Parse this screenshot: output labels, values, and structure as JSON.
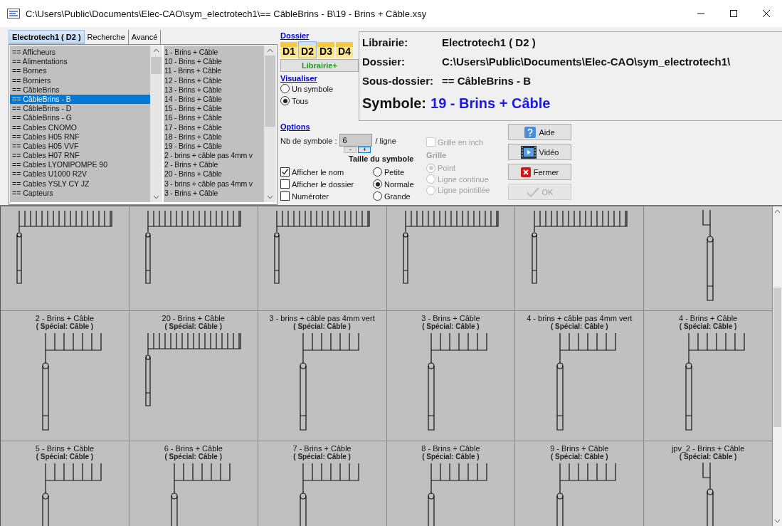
{
  "window": {
    "title": "C:\\Users\\Public\\Documents\\Elec-CAO\\sym_electrotech1\\== CâbleBrins - B\\19 - Brins + Câble.xsy"
  },
  "library_tabs": [
    {
      "label": "Electrotech1 ( D2 )",
      "selected": true
    },
    {
      "label": "Recherche",
      "selected": false
    },
    {
      "label": "Avancé",
      "selected": false
    }
  ],
  "folder_list": [
    {
      "label": "== Afficheurs",
      "selected": false
    },
    {
      "label": "== Alimentations",
      "selected": false
    },
    {
      "label": "== Bornes",
      "selected": false
    },
    {
      "label": "== Borniers",
      "selected": false
    },
    {
      "label": "== CâbleBrins",
      "selected": false
    },
    {
      "label": "== CâbleBrins - B",
      "selected": true
    },
    {
      "label": "== CâbleBrins - D",
      "selected": false
    },
    {
      "label": "== CâbleBrins - G",
      "selected": false
    },
    {
      "label": "== Cables CNOMO",
      "selected": false
    },
    {
      "label": "== Cables H05 RNF",
      "selected": false
    },
    {
      "label": "== Cables H05 VVF",
      "selected": false
    },
    {
      "label": "== Cables H07 RNF",
      "selected": false
    },
    {
      "label": "== Cables LYONIPOMPE 90",
      "selected": false
    },
    {
      "label": "== Cables U1000 R2V",
      "selected": false
    },
    {
      "label": "== Cables YSLY CY JZ",
      "selected": false
    },
    {
      "label": "== Capteurs",
      "selected": false
    }
  ],
  "symbol_list": [
    "1 - Brins + Câble",
    "10 - Brins + Câble",
    "11 - Brins + Câble",
    "12 - Brins + Câble",
    "13 - Brins + Câble",
    "14 - Brins + Câble",
    "15 - Brins + Câble",
    "16 - Brins + Câble",
    "17 - Brins + Câble",
    "18 - Brins + Câble",
    "19 - Brins + Câble",
    "2 - brins + câble pas 4mm v",
    "2 - Brins + Câble",
    "20 - Brins + Câble",
    "3 - brins + câble pas 4mm v",
    "3 - Brins + Câble"
  ],
  "dossier": {
    "heading": "Dossier",
    "drives": [
      {
        "label": "D1",
        "selected": false
      },
      {
        "label": "D2",
        "selected": true
      },
      {
        "label": "D3",
        "selected": false
      },
      {
        "label": "D4",
        "selected": false
      }
    ],
    "library_button": "Librairie+"
  },
  "visualiser": {
    "heading": "Visualiser",
    "options": [
      {
        "label": "Un symbole",
        "selected": false
      },
      {
        "label": "Tous",
        "selected": true
      }
    ]
  },
  "info": {
    "rows": [
      {
        "label": "Librairie:",
        "value": "Electrotech1 ( D2 )"
      },
      {
        "label": "Dossier:",
        "value": "C:\\Users\\Public\\Documents\\Elec-CAO\\sym_electrotech1\\"
      },
      {
        "label": "Sous-dossier:",
        "value": "== CâbleBrins - B"
      }
    ],
    "symbol_label": "Symbole:",
    "symbol_value": "19 - Brins + Câble"
  },
  "options": {
    "heading": "Options",
    "count_label": "Nb de symbole :",
    "count_value": "6",
    "count_unit": "/ ligne",
    "minus": "-",
    "plus": "+",
    "size_heading": "Taille du symbole",
    "display_checks": [
      {
        "label": "Afficher le nom",
        "checked": true
      },
      {
        "label": "Afficher le dossier",
        "checked": false
      },
      {
        "label": "Numéroter",
        "checked": false
      }
    ],
    "size_options": [
      {
        "label": "Petite",
        "selected": false
      },
      {
        "label": "Normale",
        "selected": true
      },
      {
        "label": "Grande",
        "selected": false
      }
    ],
    "grid_inch": {
      "label": "Grille en inch",
      "checked": false,
      "disabled": true
    },
    "grid_heading": "Grille",
    "grid_options": [
      {
        "label": "Point",
        "selected": true,
        "disabled": true
      },
      {
        "label": "Ligne continue",
        "selected": false,
        "disabled": true
      },
      {
        "label": "Ligne pointillée",
        "selected": false,
        "disabled": true
      }
    ]
  },
  "buttons": [
    {
      "label": "Aide",
      "kind": "help",
      "disabled": false
    },
    {
      "label": "Vidéo",
      "kind": "video",
      "disabled": false
    },
    {
      "label": "Fermer",
      "kind": "close",
      "disabled": false
    },
    {
      "label": "OK",
      "kind": "ok",
      "disabled": true
    }
  ],
  "symbols": [
    {
      "kind": "wide"
    },
    {
      "kind": "wide"
    },
    {
      "kind": "wide"
    },
    {
      "kind": "wide"
    },
    {
      "kind": "wide"
    },
    {
      "kind": "single"
    },
    {
      "name": "2 - Brins + Câble",
      "category": "( Spécial: Câble )",
      "kind": "short"
    },
    {
      "name": "20 - Brins + Câble",
      "category": "( Spécial: Câble )",
      "kind": "wide"
    },
    {
      "name": "3 - brins + câble pas 4mm vert",
      "category": "( Spécial: Câble )",
      "kind": "short"
    },
    {
      "name": "3 - Brins + Câble",
      "category": "( Spécial: Câble )",
      "kind": "short"
    },
    {
      "name": "4 - brins + câble pas 4mm vert",
      "category": "( Spécial: Câble )",
      "kind": "short"
    },
    {
      "name": "4 - Brins + Câble",
      "category": "( Spécial: Câble )",
      "kind": "short"
    },
    {
      "name": "5 - Brins + Câble",
      "category": "( Spécial: Câble )",
      "kind": "short"
    },
    {
      "name": "6 - Brins + Câble",
      "category": "( Spécial: Câble )",
      "kind": "short"
    },
    {
      "name": "7 - Brins + Câble",
      "category": "( Spécial: Câble )",
      "kind": "short"
    },
    {
      "name": "8 - Brins + Câble",
      "category": "( Spécial: Câble )",
      "kind": "short"
    },
    {
      "name": "9 - Brins + Câble",
      "category": "( Spécial: Câble )",
      "kind": "short"
    },
    {
      "name": "jpv_2 - Brins + Câble",
      "category": "( Spécial: Câble )",
      "kind": "single"
    }
  ]
}
